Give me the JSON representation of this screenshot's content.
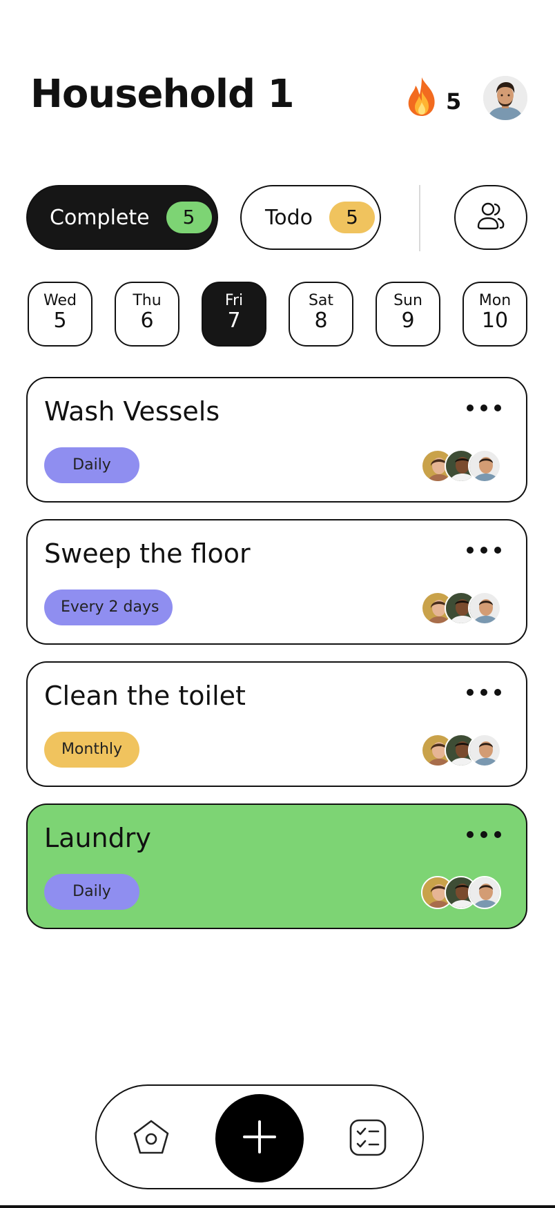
{
  "header": {
    "title": "Household 1",
    "streak_count": "5",
    "streak_icon": "fire-icon",
    "avatar": "user-avatar"
  },
  "filters": {
    "complete_label": "Complete",
    "complete_count": "5",
    "todo_label": "Todo",
    "todo_count": "5",
    "members_icon": "users-icon"
  },
  "days": [
    {
      "name": "Wed",
      "num": "5"
    },
    {
      "name": "Thu",
      "num": "6"
    },
    {
      "name": "Fri",
      "num": "7"
    },
    {
      "name": "Sat",
      "num": "8"
    },
    {
      "name": "Sun",
      "num": "9"
    },
    {
      "name": "Mon",
      "num": "10"
    }
  ],
  "selected_day": "Fri 7",
  "tasks": [
    {
      "title": "Wash Vessels",
      "frequency": "Daily",
      "status": "todo"
    },
    {
      "title": "Sweep the floor",
      "frequency": "Every 2 days",
      "status": "todo"
    },
    {
      "title": "Clean the toilet",
      "frequency": "Monthly",
      "status": "todo"
    },
    {
      "title": "Laundry",
      "frequency": "Daily",
      "status": "complete"
    }
  ],
  "nav": {
    "home_icon": "home-icon",
    "add_icon": "plus-icon",
    "tasks_icon": "checklist-icon"
  },
  "colors": {
    "complete_green": "#7dd474",
    "todo_yellow": "#f0c35e",
    "frequency_purple": "#8f8ef0",
    "dark": "#161616"
  }
}
